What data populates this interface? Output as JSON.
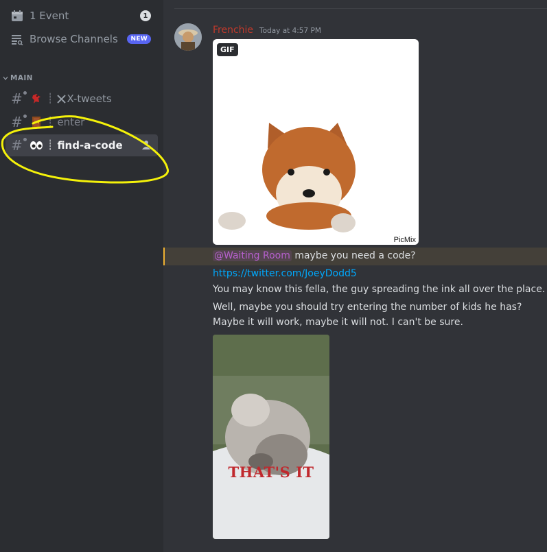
{
  "sidebar": {
    "events_label": "1 Event",
    "events_count": "1",
    "browse_label": "Browse Channels",
    "browse_badge": "NEW",
    "category": "MAIN",
    "channels": [
      {
        "label": "X-tweets",
        "emoji": "cardinal"
      },
      {
        "label": "enter",
        "emoji": "door"
      },
      {
        "label": "find-a-code",
        "emoji": "eyes"
      }
    ],
    "separator": "┊"
  },
  "message": {
    "author": "Frenchie",
    "timestamp": "Today at 4:57 PM",
    "gif_badge": "GIF",
    "gif1_watermark": "PicMix",
    "mention": "@Waiting Room",
    "mention_rest": " maybe you need a code?",
    "link": "https://twitter.com/JoeyDodd5",
    "line1": "You may know this fella, the guy spreading the ink all over the place.",
    "line2": "Well, maybe you should try entering the number of kids he has?",
    "line3": "Maybe it will work, maybe it will not. I can't be sure.",
    "gif2_caption": "THAT'S IT"
  },
  "colors": {
    "annotation": "#f5f20a",
    "author": "#c0392b",
    "link": "#00a8fc",
    "mention_highlight": "#f0b232"
  }
}
